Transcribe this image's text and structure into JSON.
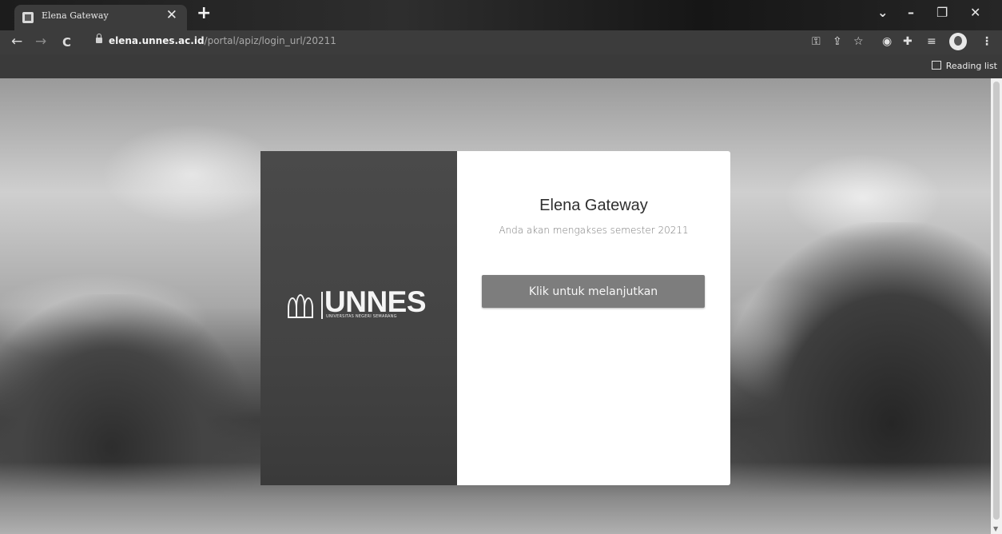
{
  "browser": {
    "tab_title": "Elena Gateway",
    "tab_close": "✕",
    "new_tab": "+",
    "window_controls": {
      "dropdown": "⌄",
      "minimize": "–",
      "restore": "❐",
      "close": "✕"
    },
    "nav": {
      "back": "←",
      "forward": "→",
      "reload": "C"
    },
    "url_host": "elena.unnes.ac.id",
    "url_path": "/portal/apiz/login_url/20211",
    "toolbar_icons": [
      "key-icon",
      "share-icon",
      "star-icon",
      "extension-circle-icon",
      "extensions-puzzle-icon",
      "reading-list-icon",
      "profile-avatar",
      "more-menu-icon"
    ],
    "reading_list_label": "Reading list"
  },
  "brand": {
    "logo_text": "UNNES",
    "logo_subtext": "UNIVERSITAS NEGERI SEMARANG"
  },
  "login": {
    "title": "Elena Gateway",
    "subtitle": "Anda akan mengakses semester 20211",
    "button_label": "Klik untuk melanjutkan"
  }
}
